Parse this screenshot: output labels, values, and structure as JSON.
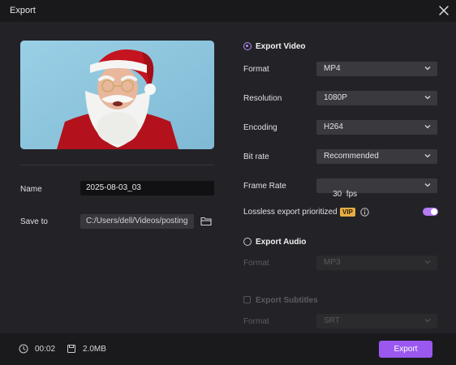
{
  "window": {
    "title": "Export"
  },
  "left": {
    "name_label": "Name",
    "name_value": "2025-08-03_03",
    "save_label": "Save to",
    "save_value": "C:/Users/dell/Videos/posting"
  },
  "export_video": {
    "label": "Export Video",
    "selected": true,
    "rows": [
      {
        "label": "Format",
        "value": "MP4"
      },
      {
        "label": "Resolution",
        "value": "1080P"
      },
      {
        "label": "Encoding",
        "value": "H264"
      },
      {
        "label": "Bit rate",
        "value": "Recommended"
      },
      {
        "label": "Frame Rate",
        "value": "30  fps"
      }
    ],
    "lossless_label": "Lossless export prioritized",
    "vip_badge": "VIP",
    "lossless_enabled": true
  },
  "export_audio": {
    "label": "Export Audio",
    "selected": false,
    "format_label": "Format",
    "format_value": "MP3"
  },
  "export_subtitles": {
    "label": "Export Subtitles",
    "checked": false,
    "format_label": "Format",
    "format_value": "SRT"
  },
  "footer": {
    "duration": "00:02",
    "size": "2.0MB",
    "export_label": "Export"
  },
  "icons": {
    "close": "close-icon",
    "folder": "folder-icon",
    "info": "info-icon",
    "clock": "clock-icon",
    "disk": "file-size-icon",
    "chevron": "chevron-down-icon"
  },
  "colors": {
    "accent": "#9b58f0",
    "radio_on": "#b78bff",
    "vip": "#e7ad43",
    "toggle_on": "#b57bf4"
  }
}
